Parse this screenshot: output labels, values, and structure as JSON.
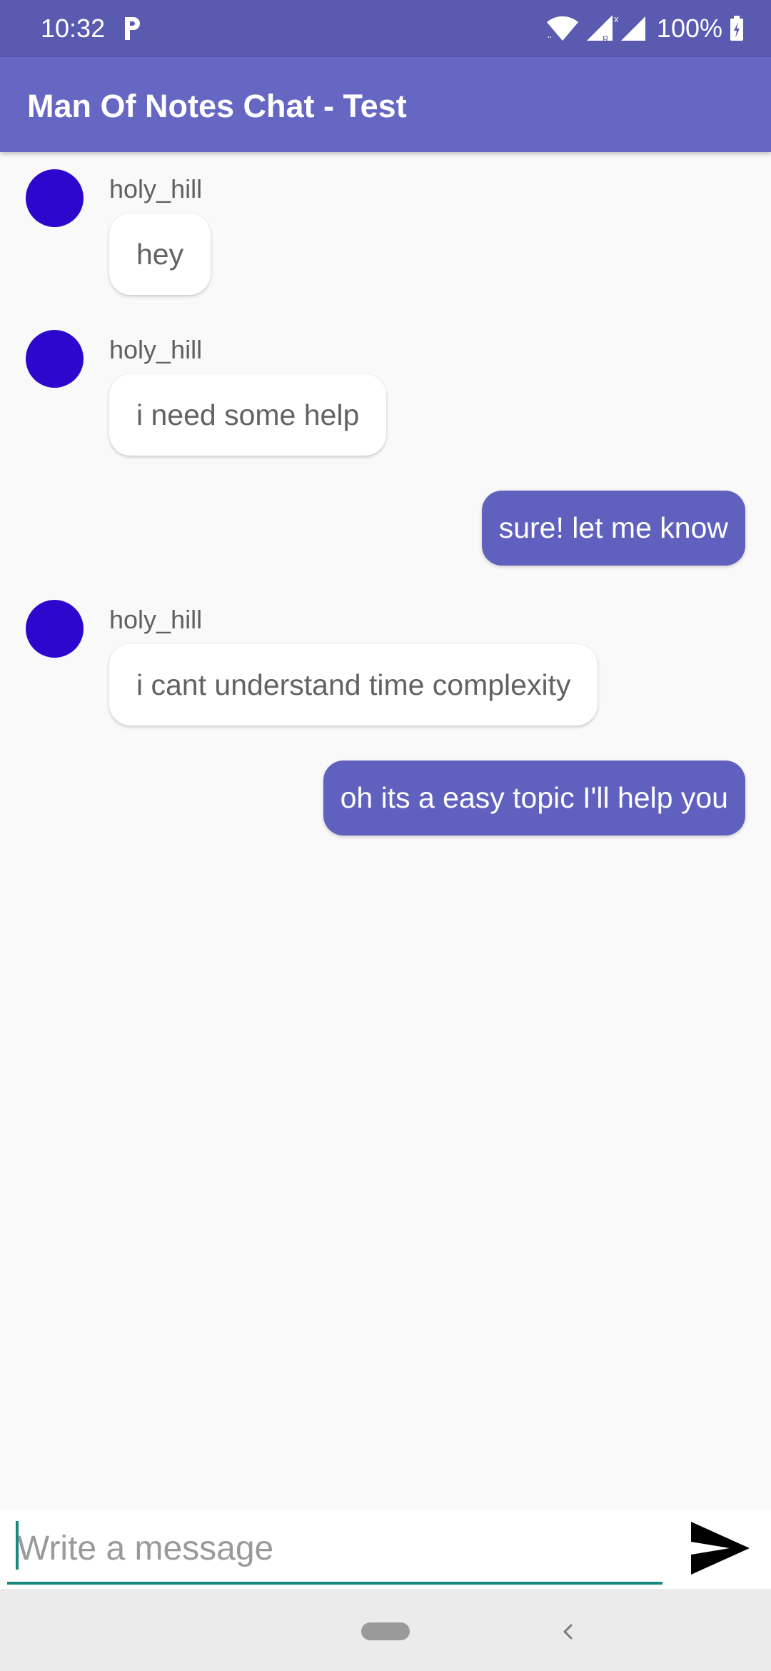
{
  "status_bar": {
    "time": "10:32",
    "battery": "100%",
    "icons": [
      "parking-icon",
      "wifi-icon",
      "cell-signal-icon",
      "cell-signal-icon",
      "battery-charging-icon"
    ]
  },
  "app_bar": {
    "title": "Man Of Notes Chat - Test"
  },
  "messages": [
    {
      "direction": "incoming",
      "sender": "holy_hill",
      "text": "hey"
    },
    {
      "direction": "incoming",
      "sender": "holy_hill",
      "text": "i need some help"
    },
    {
      "direction": "outgoing",
      "text": "sure! let me know"
    },
    {
      "direction": "incoming",
      "sender": "holy_hill",
      "text": "i cant understand time complexity"
    },
    {
      "direction": "outgoing",
      "text": "oh its a easy topic I'll help you"
    }
  ],
  "composer": {
    "placeholder": "Write a message",
    "value": "",
    "send_icon": "send-icon"
  },
  "nav_bar": {
    "icons": [
      "home-pill",
      "back-chevron-icon"
    ]
  },
  "colors": {
    "status_bar": "#5a5ab0",
    "app_bar": "#6667c2",
    "avatar": "#2e07cc",
    "outgoing_bubble": "#6061be",
    "input_underline": "#16897f",
    "background": "#f9f9f9"
  }
}
